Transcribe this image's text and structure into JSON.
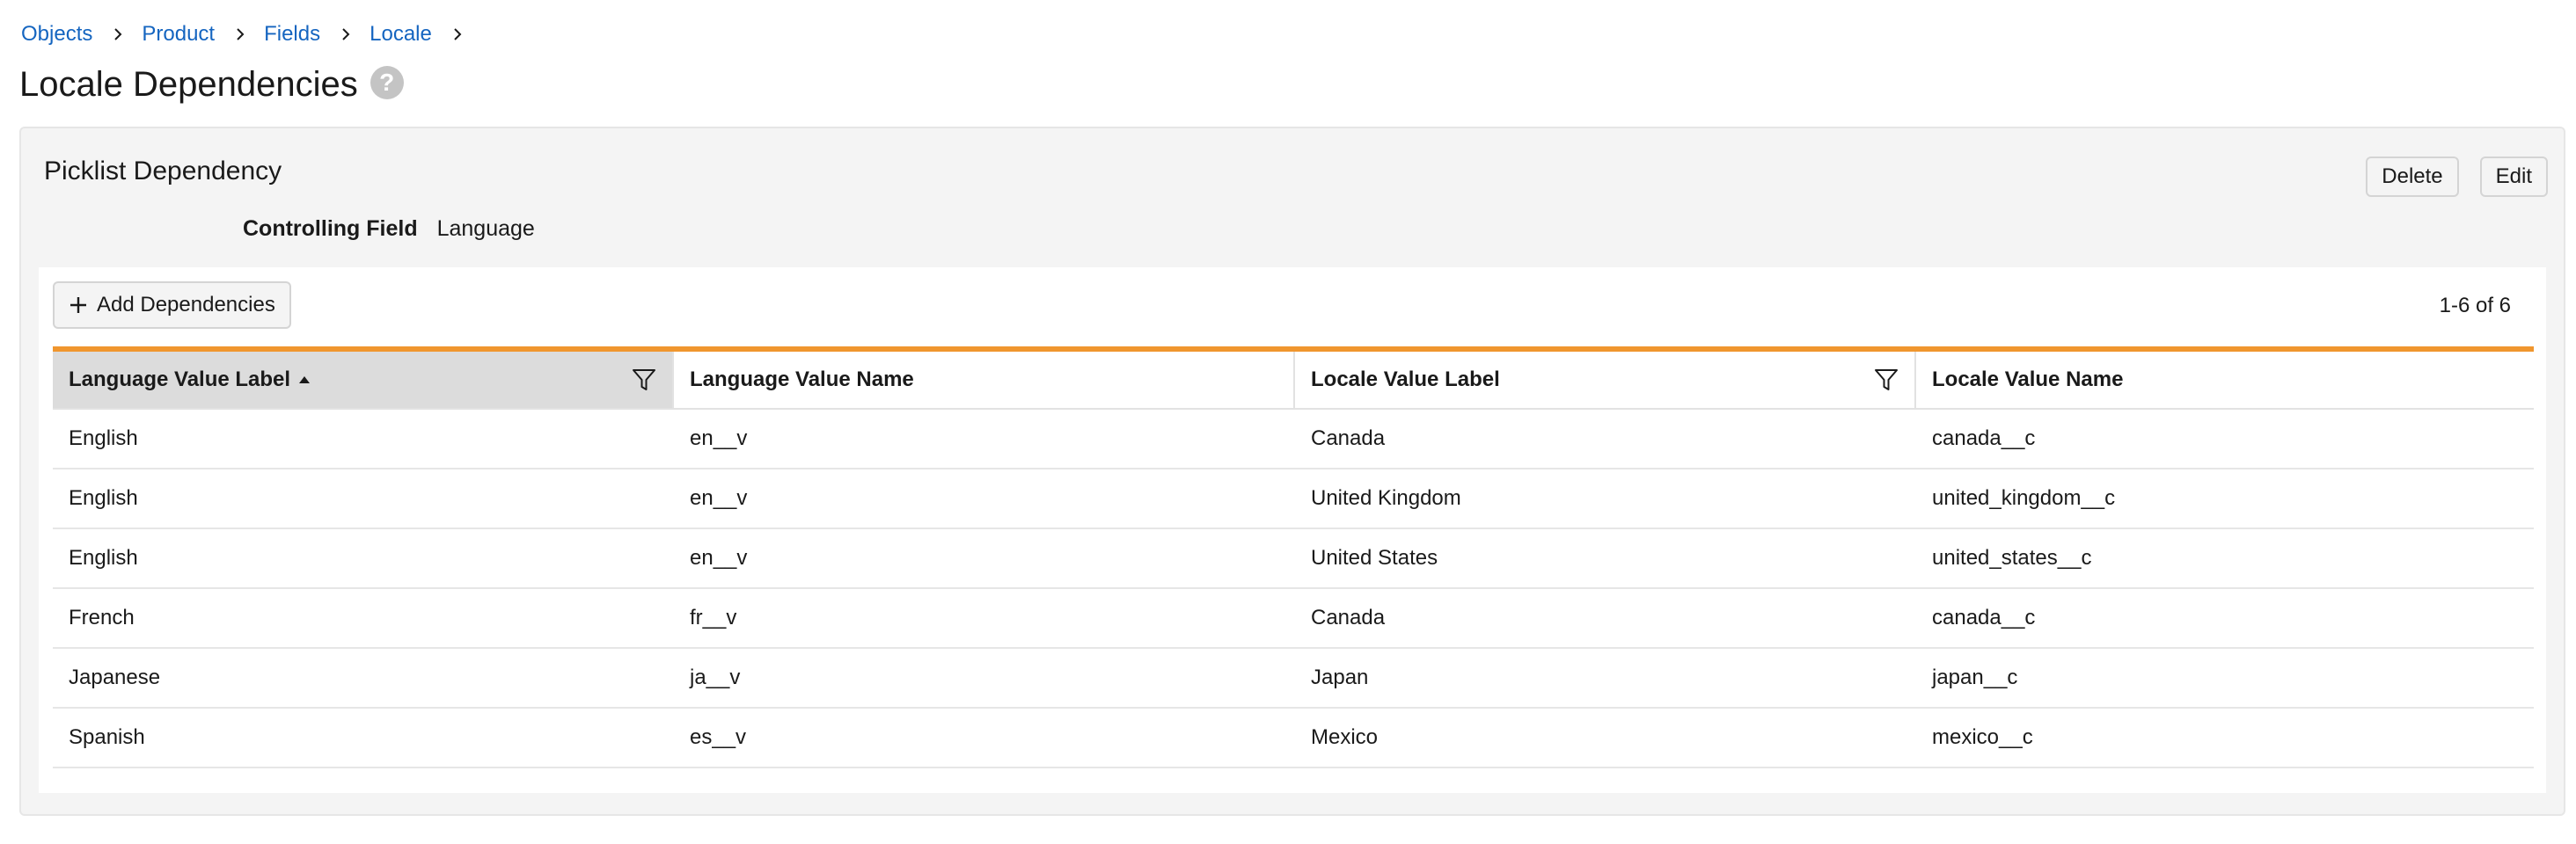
{
  "breadcrumb": [
    "Objects",
    "Product",
    "Fields",
    "Locale"
  ],
  "page": {
    "title": "Locale Dependencies",
    "help_glyph": "?"
  },
  "panel": {
    "title": "Picklist Dependency",
    "delete_label": "Delete",
    "edit_label": "Edit",
    "controlling_field_label": "Controlling Field",
    "controlling_field_value": "Language"
  },
  "table": {
    "add_label": "Add Dependencies",
    "count": "1-6 of 6",
    "accent_color": "#f0962e",
    "sorted_column": "Language Value Label",
    "sort_direction": "ascending",
    "columns": [
      "Language Value Label",
      "Language Value Name",
      "Locale Value Label",
      "Locale Value Name"
    ],
    "rows": [
      [
        "English",
        "en__v",
        "Canada",
        "canada__c"
      ],
      [
        "English",
        "en__v",
        "United Kingdom",
        "united_kingdom__c"
      ],
      [
        "English",
        "en__v",
        "United States",
        "united_states__c"
      ],
      [
        "French",
        "fr__v",
        "Canada",
        "canada__c"
      ],
      [
        "Japanese",
        "ja__v",
        "Japan",
        "japan__c"
      ],
      [
        "Spanish",
        "es__v",
        "Mexico",
        "mexico__c"
      ]
    ]
  },
  "colors": {
    "link": "#1565c0",
    "sorted_header_bg": "#dcdcdc",
    "panel_bg": "#f4f4f4"
  }
}
